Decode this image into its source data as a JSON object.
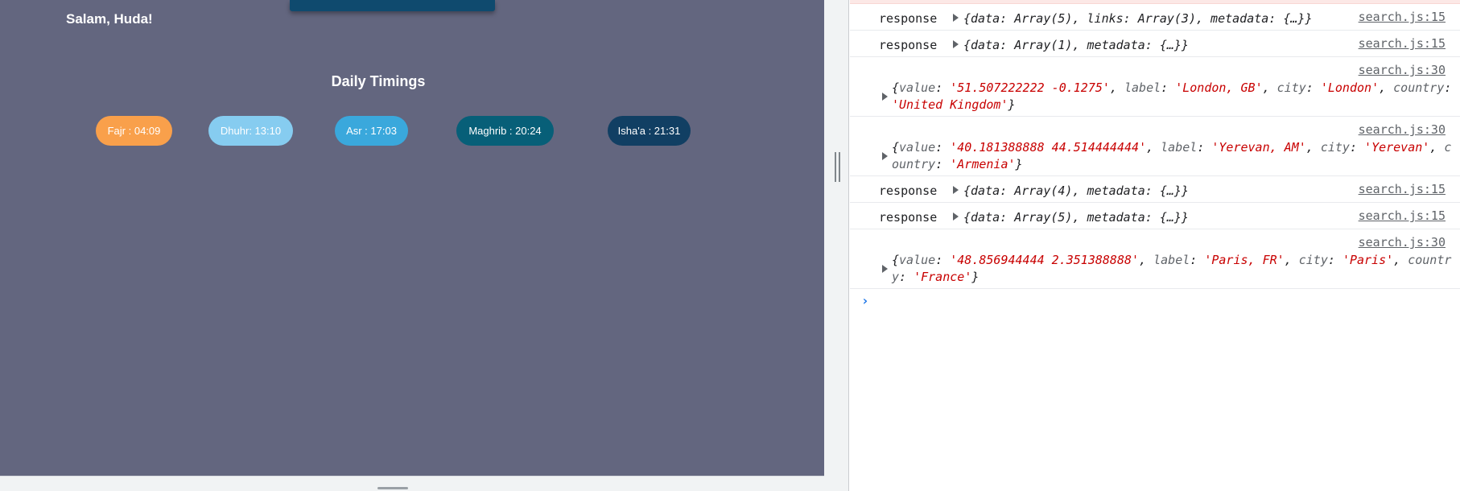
{
  "app": {
    "greeting": "Salam, Huda!",
    "section_title": "Daily Timings",
    "prayers": [
      {
        "label": "Fajr : 04:09",
        "color": "#f9a04b"
      },
      {
        "label": "Dhuhr: 13:10",
        "color": "#86ccf0"
      },
      {
        "label": "Asr : 17:03",
        "color": "#3aa8dc"
      },
      {
        "label": "Maghrib : 20:24",
        "color": "#075f78"
      },
      {
        "label": "Isha'a : 21:31",
        "color": "#113f63"
      }
    ],
    "background_color": "#63667f"
  },
  "console": {
    "entries": [
      {
        "type": "single",
        "label": "response",
        "source": "search.js:15",
        "preview": "{data: Array(5), links: Array(3), metadata: {…}}"
      },
      {
        "type": "single",
        "label": "response",
        "source": "search.js:15",
        "preview": "{data: Array(1), metadata: {…}}"
      },
      {
        "type": "multi",
        "source": "search.js:30",
        "value": "51.507222222 -0.1275",
        "label_val": "London, GB",
        "city": "London",
        "country": "United Kingdom"
      },
      {
        "type": "multi",
        "source": "search.js:30",
        "value": "40.181388888 44.514444444",
        "label_val": "Yerevan, AM",
        "city": "Yerevan",
        "country": "Armenia"
      },
      {
        "type": "single",
        "label": "response",
        "source": "search.js:15",
        "preview": "{data: Array(4), metadata: {…}}"
      },
      {
        "type": "single",
        "label": "response",
        "source": "search.js:15",
        "preview": "{data: Array(5), metadata: {…}}"
      },
      {
        "type": "multi",
        "source": "search.js:30",
        "value": "48.856944444 2.351388888",
        "label_val": "Paris, FR",
        "city": "Paris",
        "country": "France"
      }
    ],
    "prompt": "›"
  }
}
